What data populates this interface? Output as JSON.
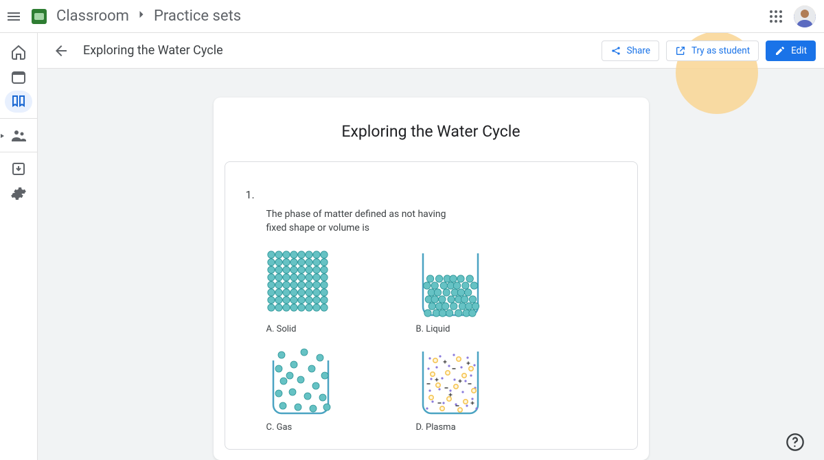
{
  "topbar": {
    "app_name": "Classroom",
    "breadcrumb_page": "Practice sets"
  },
  "subheader": {
    "title": "Exploring the Water Cycle",
    "share_label": "Share",
    "try_label": "Try as student",
    "edit_label": "Edit"
  },
  "sheet": {
    "title": "Exploring the Water Cycle",
    "question": {
      "number": "1.",
      "text": "The phase of matter defined as not having fixed shape or volume is",
      "options": [
        {
          "label": "A. Solid",
          "kind": "solid"
        },
        {
          "label": "B. Liquid",
          "kind": "liquid"
        },
        {
          "label": "C. Gas",
          "kind": "gas"
        },
        {
          "label": "D. Plasma",
          "kind": "plasma"
        }
      ]
    }
  },
  "sidebar": {
    "items": [
      {
        "id": "home",
        "active": false
      },
      {
        "id": "calendar",
        "active": false
      },
      {
        "id": "library",
        "active": true
      },
      {
        "id": "people",
        "active": false
      },
      {
        "id": "archive",
        "active": false
      },
      {
        "id": "settings",
        "active": false
      }
    ]
  },
  "colors": {
    "teal": "#66c2c4",
    "beaker": "#4aa3c2",
    "plasma_ring": "#f5c555",
    "plasma_minus": "#333"
  }
}
